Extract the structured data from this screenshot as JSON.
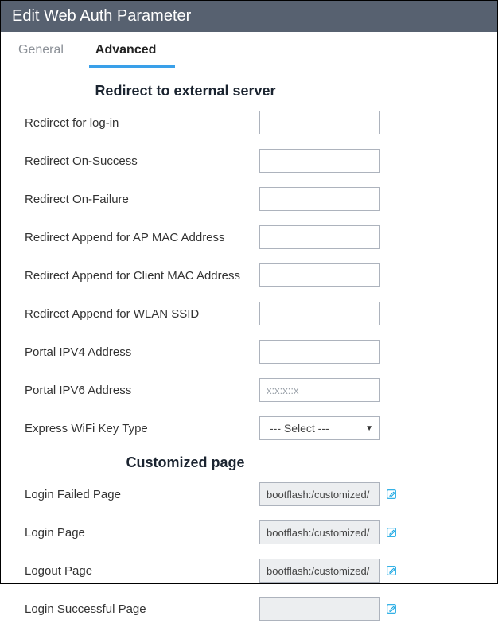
{
  "title": "Edit Web Auth Parameter",
  "tabs": {
    "general": "General",
    "advanced": "Advanced"
  },
  "section1_heading": "Redirect to external server",
  "redirect_login": {
    "label": "Redirect for log-in",
    "value": ""
  },
  "redirect_success": {
    "label": "Redirect On-Success",
    "value": ""
  },
  "redirect_failure": {
    "label": "Redirect On-Failure",
    "value": ""
  },
  "redirect_ap_mac": {
    "label": "Redirect Append for AP MAC Address",
    "value": ""
  },
  "redirect_client_mac": {
    "label": "Redirect Append for Client MAC Address",
    "value": ""
  },
  "redirect_wlan_ssid": {
    "label": "Redirect Append for WLAN SSID",
    "value": ""
  },
  "portal_ipv4": {
    "label": "Portal IPV4 Address",
    "value": ""
  },
  "portal_ipv6": {
    "label": "Portal IPV6 Address",
    "value": "",
    "placeholder": "x:x:x::x"
  },
  "express_wifi": {
    "label": "Express WiFi Key Type",
    "selected": "--- Select ---"
  },
  "section2_heading": "Customized page",
  "login_failed_page": {
    "label": "Login Failed Page",
    "value": "bootflash:/customized/"
  },
  "login_page": {
    "label": "Login Page",
    "value": "bootflash:/customized/"
  },
  "logout_page": {
    "label": "Logout Page",
    "value": "bootflash:/customized/"
  },
  "login_success_page": {
    "label": "Login Successful Page",
    "value": ""
  }
}
